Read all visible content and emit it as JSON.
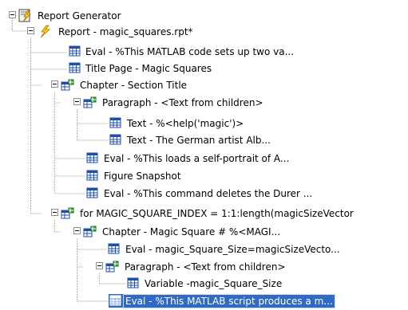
{
  "tree": {
    "root_label": "Report Generator",
    "nodes": [
      {
        "label": "Report - magic_squares.rpt*",
        "icon": "report-icon",
        "depth": 1
      },
      {
        "label": "Eval - %This MATLAB code sets up two va...",
        "icon": "component-icon",
        "depth": 2
      },
      {
        "label": "Title Page - Magic Squares",
        "icon": "component-icon",
        "depth": 2
      },
      {
        "label": "Chapter - Section Title",
        "icon": "container-icon",
        "depth": 2
      },
      {
        "label": "Paragraph - <Text from children>",
        "icon": "container-icon",
        "depth": 3
      },
      {
        "label": "Text -  %<help('magic')>",
        "icon": "component-icon",
        "depth": 4
      },
      {
        "label": "Text - The German artist Alb...",
        "icon": "component-icon",
        "depth": 4
      },
      {
        "label": "Eval - %This loads a self-portrait of A...",
        "icon": "component-icon",
        "depth": 3
      },
      {
        "label": "Figure Snapshot",
        "icon": "component-icon",
        "depth": 3
      },
      {
        "label": "Eval - %This command deletes the Durer ...",
        "icon": "component-icon",
        "depth": 3
      },
      {
        "label": "for MAGIC_SQUARE_INDEX = 1:1:length(magicSizeVector",
        "icon": "container-icon",
        "depth": 2
      },
      {
        "label": "Chapter - Magic Square # %<MAGI...",
        "icon": "container-icon",
        "depth": 3
      },
      {
        "label": "Eval - magic_Square_Size=magicSizeVecto...",
        "icon": "component-icon",
        "depth": 4
      },
      {
        "label": "Paragraph - <Text from children>",
        "icon": "container-icon",
        "depth": 4
      },
      {
        "label": "Variable -magic_Square_Size",
        "icon": "component-icon",
        "depth": 5
      },
      {
        "label": "Eval - %This MATLAB script produces a m...",
        "icon": "component-icon",
        "depth": 4,
        "selected": true
      }
    ],
    "colors": {
      "selection": "#316ac5",
      "selection_text": "#ffffff",
      "tree_lines": "#a0a0a0"
    }
  }
}
